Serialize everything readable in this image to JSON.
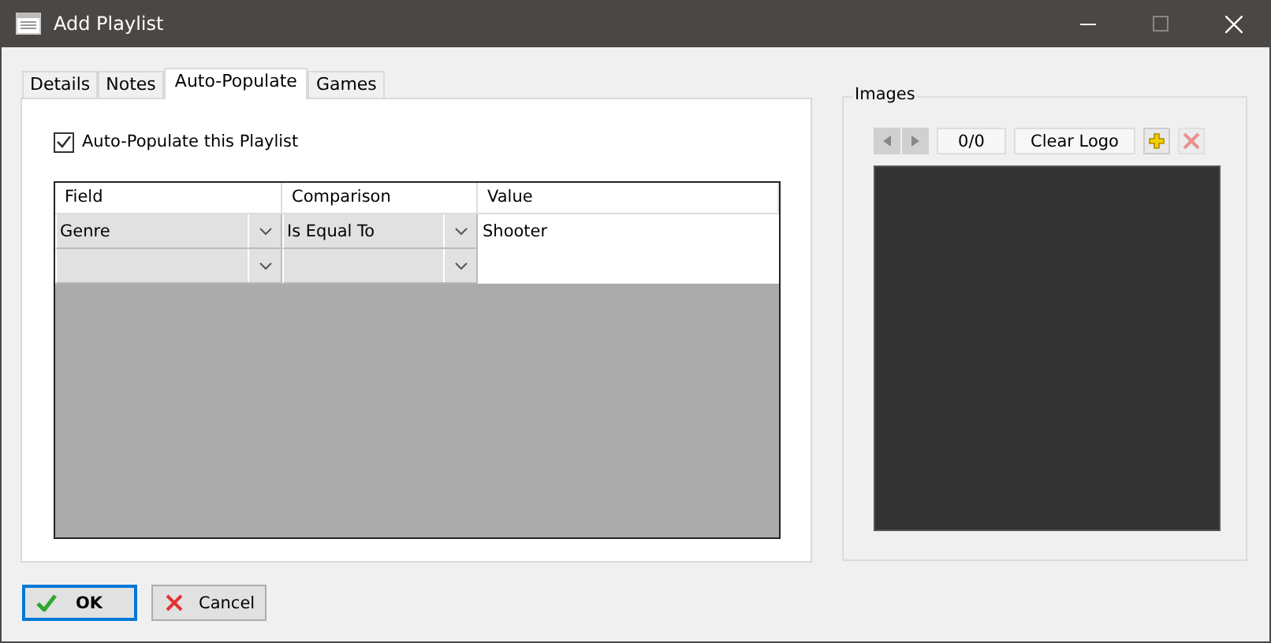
{
  "window": {
    "title": "Add Playlist"
  },
  "tabs": [
    {
      "label": "Details",
      "selected": false
    },
    {
      "label": "Notes",
      "selected": false
    },
    {
      "label": "Auto-Populate",
      "selected": true
    },
    {
      "label": "Games",
      "selected": false
    }
  ],
  "auto_populate": {
    "label": "Auto-Populate this Playlist",
    "checked": true
  },
  "grid": {
    "columns": [
      "Field",
      "Comparison",
      "Value"
    ],
    "rows": [
      {
        "field": "Genre",
        "comparison": "Is Equal To",
        "value": "Shooter"
      },
      {}
    ]
  },
  "images": {
    "title": "Images",
    "previous_disabled": true,
    "next_disabled": true,
    "counter": "0/0",
    "image_type": "Clear Logo",
    "delete_disabled": true
  },
  "buttons": [
    {
      "label": "OK",
      "kind": "ok",
      "focused": true
    },
    {
      "label": "Cancel",
      "kind": "cancel",
      "focused": false
    }
  ]
}
